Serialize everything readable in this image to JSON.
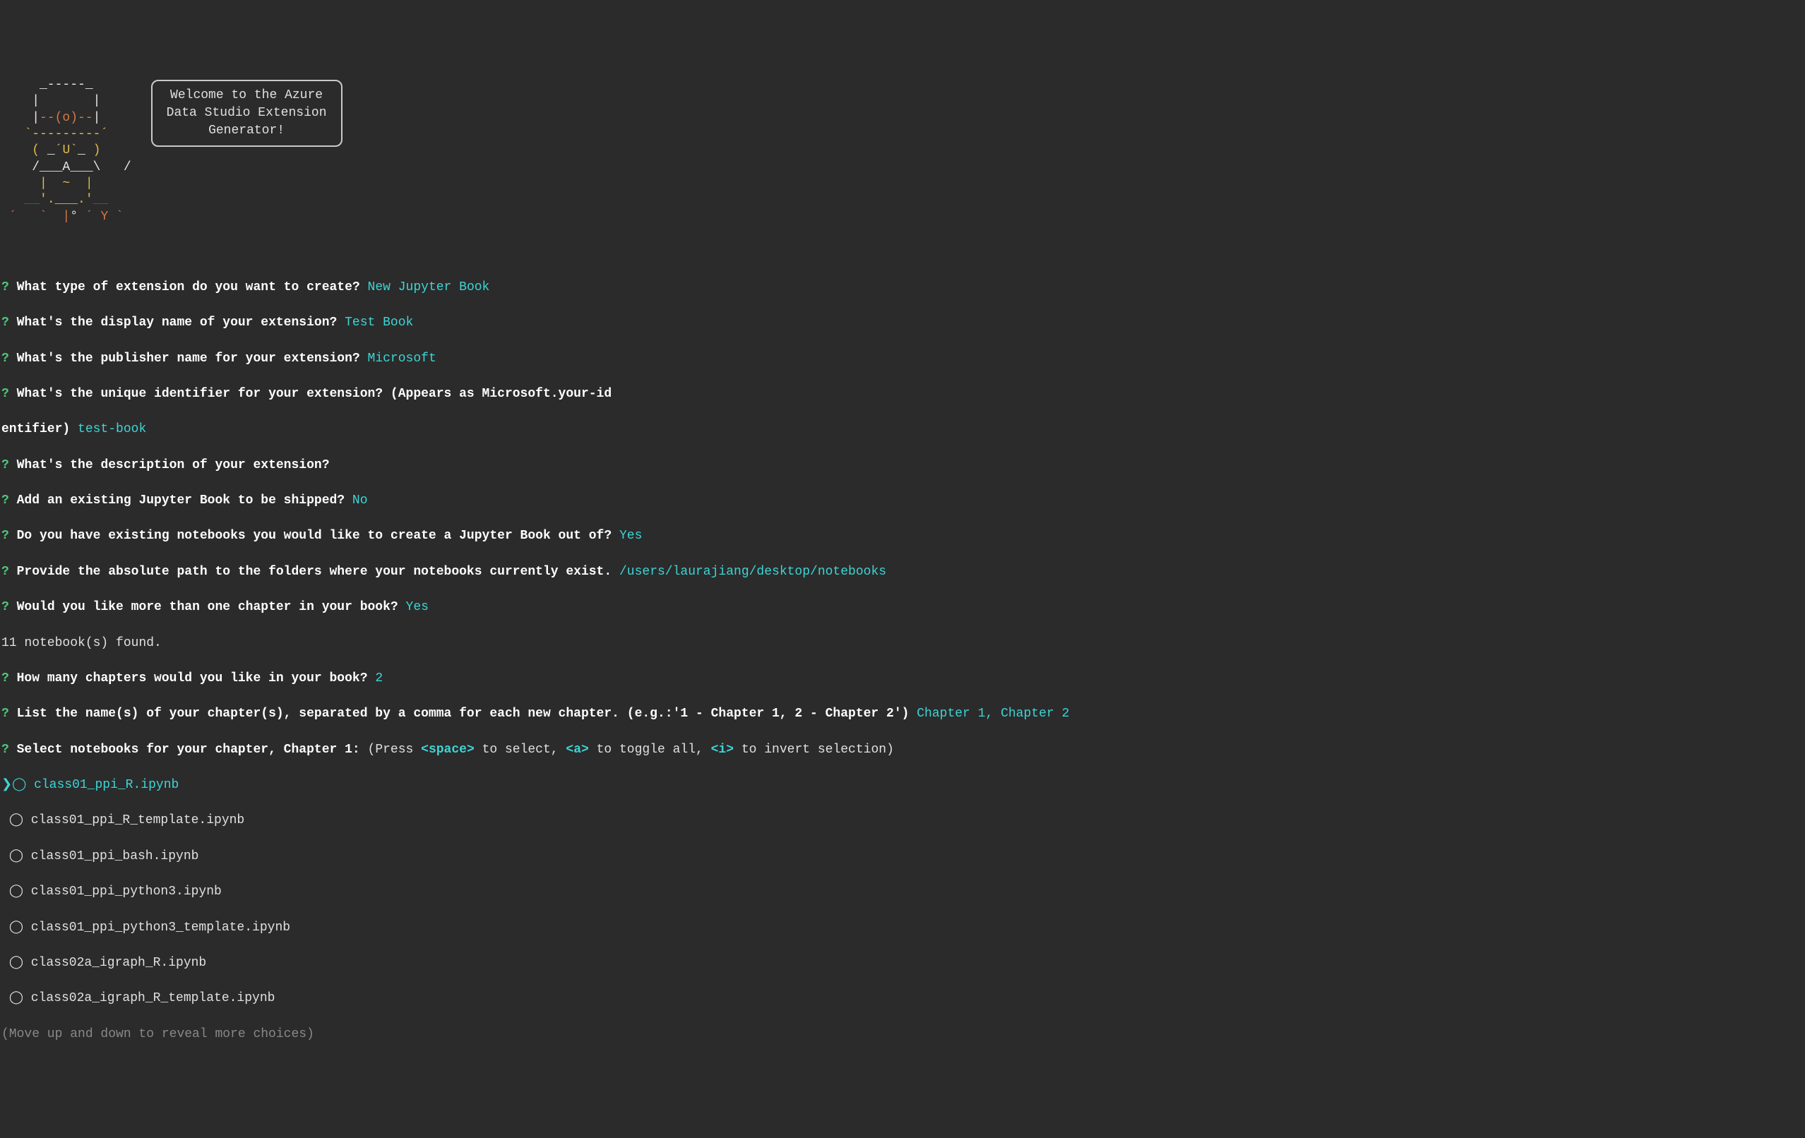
{
  "ascii_art": {
    "l1": "     _-----_     ",
    "l2": "    |       |    ",
    "l3_a": "    |",
    "l3_b": "--(o)--",
    "l3_c": "|    ",
    "l4_a": "   `---------´   ",
    "l5_a": "    ",
    "l5_b": "(",
    "l5_c": " _",
    "l5_d": "´U`",
    "l5_e": "_ ",
    "l5_f": ")",
    "l6": "    /___A___\\   /",
    "l7_a": "     ",
    "l7_b": "|  ~  |",
    "l8_a": "   __",
    "l8_b": "'.___.'",
    "l8_c": "__   ",
    "l9_a": " ´   ",
    "l9_b": "`  |",
    "l9_c": "° ",
    "l9_d": "´ Y",
    "l9_e": " ` "
  },
  "welcome": {
    "line1": "Welcome to the Azure",
    "line2": "Data Studio Extension",
    "line3": "Generator!"
  },
  "prompts": [
    {
      "q": "What type of extension do you want to create?",
      "a": "New Jupyter Book"
    },
    {
      "q": "What's the display name of your extension?",
      "a": "Test Book"
    },
    {
      "q": "What's the publisher name for your extension?",
      "a": "Microsoft"
    },
    {
      "q": "What's the unique identifier for your extension? (Appears as Microsoft.your-id",
      "cont": "entifier)",
      "a": "test-book"
    },
    {
      "q": "What's the description of your extension?",
      "a": ""
    },
    {
      "q": "Add an existing Jupyter Book to be shipped?",
      "a": "No"
    },
    {
      "q": "Do you have existing notebooks you would like to create a Jupyter Book out of?",
      "a": "Yes"
    },
    {
      "q": "Provide the absolute path to the folders where your notebooks currently exist.",
      "a": "/users/laurajiang/desktop/notebooks"
    },
    {
      "q": "Would you like more than one chapter in your book?",
      "a": "Yes"
    }
  ],
  "notebooks_found": "11 notebook(s) found.",
  "prompts2": [
    {
      "q": "How many chapters would you like in your book?",
      "a": "2"
    },
    {
      "q": "List the name(s) of your chapter(s), separated by a comma for each new chapter. (e.g.:'1 - Chapter 1, 2 - Chapter 2')",
      "a": "Chapter 1, Chapter 2"
    }
  ],
  "select_prompt": {
    "q": "Select notebooks for your chapter, Chapter 1:",
    "instr_pre": " (Press ",
    "key1": "<space>",
    "instr_mid1": " to select, ",
    "key2": "<a>",
    "instr_mid2": " to toggle all, ",
    "key3": "<i>",
    "instr_post": " to invert selection)"
  },
  "checklist": {
    "cursor": "❯",
    "selected": "class01_ppi_R.ipynb",
    "items": [
      "class01_ppi_R_template.ipynb",
      "class01_ppi_bash.ipynb",
      "class01_ppi_python3.ipynb",
      "class01_ppi_python3_template.ipynb",
      "class02a_igraph_R.ipynb",
      "class02a_igraph_R_template.ipynb"
    ]
  },
  "move_hint": "(Move up and down to reveal more choices)"
}
